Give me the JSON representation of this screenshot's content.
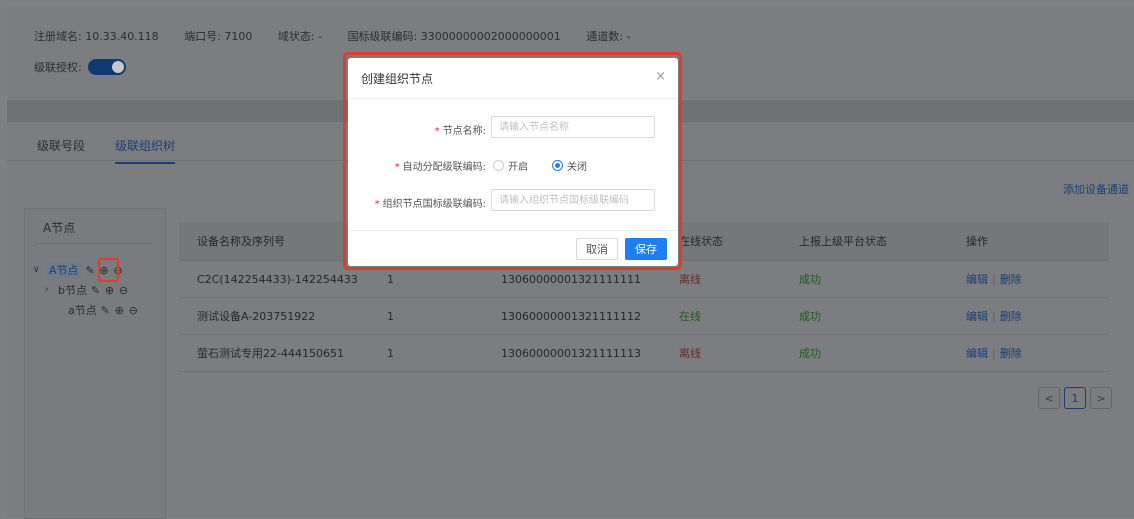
{
  "header": {
    "domain_label": "注册域名: 10.33.40.118",
    "port_label": "端口号: 7100",
    "domain_status": "域状态: -",
    "cascade_code": "国标级联编码: 33000000002000000001",
    "channel_count": "通道数: -",
    "cascade_auth_label": "级联授权:",
    "cascade_auth_enabled": true
  },
  "tabs": [
    {
      "label": "级联号段",
      "active": false
    },
    {
      "label": "级联组织树",
      "active": true
    }
  ],
  "add_device_link": "添加设备通道",
  "tree": {
    "title": "A节点",
    "nodes": [
      {
        "label": "A节点",
        "expanded": true,
        "level": 0
      },
      {
        "label": "b节点",
        "expanded": false,
        "level": 1
      },
      {
        "label": "a节点",
        "level": 1
      }
    ]
  },
  "table": {
    "columns": [
      "设备名称及序列号",
      "",
      "",
      "在线状态",
      "上报上级平台状态",
      "操作"
    ],
    "rows": [
      {
        "name": "C2C(142254433)-142254433",
        "channel": "1",
        "code": "13060000001321111111",
        "online": "离线",
        "report": "成功"
      },
      {
        "name": "测试设备A-203751922",
        "channel": "1",
        "code": "13060000001321111112",
        "online": "在线",
        "report": "成功"
      },
      {
        "name": "萤石测试专用22-444150651",
        "channel": "1",
        "code": "13060000001321111113",
        "online": "离线",
        "report": "成功"
      }
    ],
    "edit_label": "编辑",
    "delete_label": "删除"
  },
  "pagination": {
    "prev": "<",
    "current": "1",
    "next": ">"
  },
  "modal": {
    "title": "创建组织节点",
    "close_icon": "×",
    "node_name_label": "节点名称:",
    "node_name_placeholder": "请输入节点名称",
    "auto_assign_label": "自动分配级联编码:",
    "option_on": "开启",
    "option_off": "关闭",
    "selected_option": "关闭",
    "org_code_label": "组织节点国标级联编码:",
    "org_code_placeholder": "请输入组织节点国标级联编码",
    "cancel_label": "取消",
    "save_label": "保存"
  },
  "colors": {
    "primary": "#1f7ef0",
    "highlight": "#e23b2b",
    "required": "#f5222d"
  }
}
